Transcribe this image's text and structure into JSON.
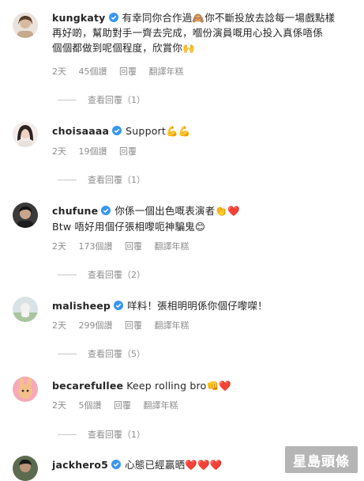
{
  "comments": [
    {
      "username": "kungkaty",
      "text_lines": [
        "有幸同你合作過🙈你不斷投放去諗每一場戲點樣",
        "再好啲，幫助對手一齊去完成，嗰份演員嘅用心投入真係唔係",
        "個個都做到呢個程度，欣賞你🙌"
      ],
      "time": "2天",
      "likes": "45個讚",
      "reply": "回覆",
      "translate": "翻譯年糕",
      "view_replies": "查看回覆（1）"
    },
    {
      "username": "choisaaaa",
      "text_lines": [
        "Support💪💪"
      ],
      "time": "2天",
      "likes": "19個讚",
      "reply": "回覆",
      "translate": "",
      "view_replies": "查看回覆（1）"
    },
    {
      "username": "chufune",
      "text_lines": [
        "你係一個出色嘅表演者👏❤️",
        "Btw 唔好用個仔張相嚟呃神騙鬼😊"
      ],
      "time": "2天",
      "likes": "173個讚",
      "reply": "回覆",
      "translate": "翻譯年糕",
      "view_replies": "查看回覆（2）"
    },
    {
      "username": "malisheep",
      "text_lines": [
        "咩料！張相明明係你個仔嚟㗎！"
      ],
      "time": "2天",
      "likes": "299個讚",
      "reply": "回覆",
      "translate": "翻譯年糕",
      "view_replies": "查看回覆（5）"
    },
    {
      "username": "becarefullee",
      "text_lines": [
        "Keep rolling bro👊❤️"
      ],
      "time": "2天",
      "likes": "5個讚",
      "reply": "回覆",
      "translate": "翻譯年糕",
      "view_replies": "查看回覆（1）"
    },
    {
      "username": "jackhero5",
      "text_lines": [
        "心態已經贏晒❤️❤️❤️"
      ],
      "time": "",
      "likes": "",
      "reply": "",
      "translate": "",
      "view_replies": ""
    }
  ],
  "watermark": "星島頭條",
  "colors": {
    "verified": "#3897f0",
    "meta": "#8e8e8e",
    "heart": "#e0245e"
  }
}
